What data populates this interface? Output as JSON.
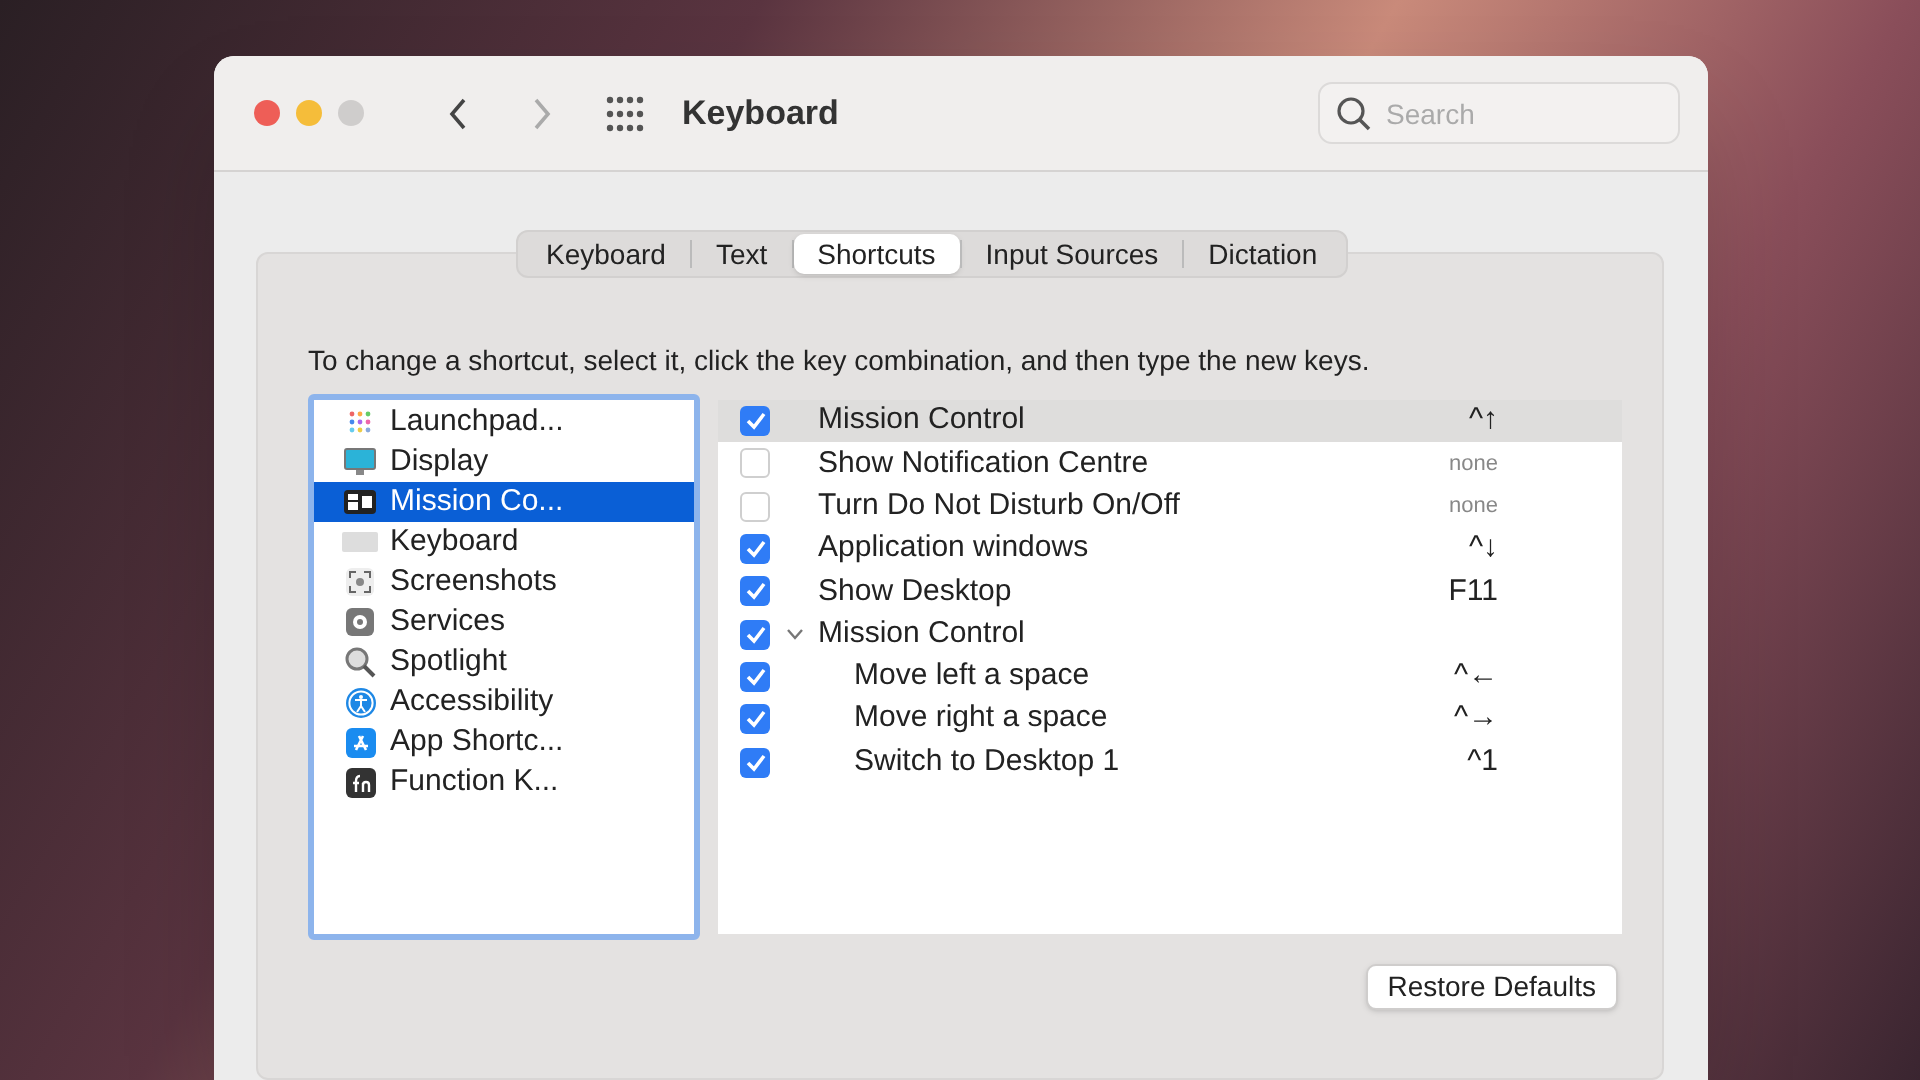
{
  "window": {
    "title": "Keyboard",
    "search": {
      "placeholder": "Search"
    }
  },
  "tabs": [
    {
      "label": "Keyboard",
      "selected": false
    },
    {
      "label": "Text",
      "selected": false
    },
    {
      "label": "Shortcuts",
      "selected": true
    },
    {
      "label": "Input Sources",
      "selected": false
    },
    {
      "label": "Dictation",
      "selected": false
    }
  ],
  "instructions": "To change a shortcut, select it, click the key combination, and then type the new keys.",
  "categories": [
    {
      "label": "Launchpad...",
      "selected": false
    },
    {
      "label": "Display",
      "selected": false
    },
    {
      "label": "Mission Co...",
      "selected": true
    },
    {
      "label": "Keyboard",
      "selected": false
    },
    {
      "label": "Screenshots",
      "selected": false
    },
    {
      "label": "Services",
      "selected": false
    },
    {
      "label": "Spotlight",
      "selected": false
    },
    {
      "label": "Accessibility",
      "selected": false
    },
    {
      "label": "App Shortc...",
      "selected": false
    },
    {
      "label": "Function K...",
      "selected": false
    }
  ],
  "shortcuts": [
    {
      "label": "Mission Control",
      "checked": true,
      "selected": true,
      "keys": "^↑",
      "assigned": true
    },
    {
      "label": "Show Notification Centre",
      "checked": false,
      "selected": false,
      "keys": "none",
      "assigned": false
    },
    {
      "label": "Turn Do Not Disturb On/Off",
      "checked": false,
      "selected": false,
      "keys": "none",
      "assigned": false
    },
    {
      "label": "Application windows",
      "checked": true,
      "selected": false,
      "keys": "^↓",
      "assigned": true
    },
    {
      "label": "Show Desktop",
      "checked": true,
      "selected": false,
      "keys": "F11",
      "assigned": true
    },
    {
      "label": "Mission Control",
      "checked": true,
      "selected": false,
      "expanded": true,
      "children": [
        {
          "label": "Move left a space",
          "checked": true,
          "selected": false,
          "keys": "^←",
          "assigned": true
        },
        {
          "label": "Move right a space",
          "checked": true,
          "selected": false,
          "keys": "^→",
          "assigned": true
        },
        {
          "label": "Switch to Desktop 1",
          "checked": true,
          "selected": false,
          "keys": "^1",
          "assigned": true
        }
      ]
    }
  ],
  "restore_button": "Restore Defaults"
}
